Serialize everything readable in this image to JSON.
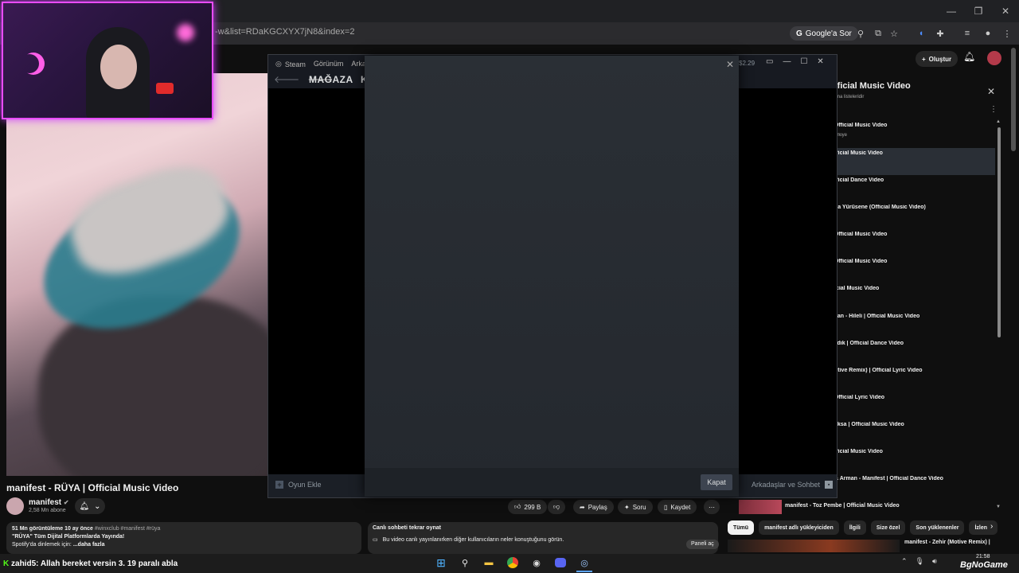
{
  "browser": {
    "url_fragment": "-w&list=RDaKGCXYX7jN8&index=2",
    "google_ask_label": "Google'a Sor",
    "window_controls": [
      "—",
      "❐",
      "✕"
    ]
  },
  "youtube": {
    "create_label": "Oluştur",
    "video_title": "manifest - RÜYA | Official Music Video",
    "channel_name": "manifest",
    "subscribers": "2,58 Mn abone",
    "likes": "299 B",
    "share_label": "Paylaş",
    "ask_label": "Soru",
    "save_label": "Kaydet",
    "description": {
      "meta": "51 Mn görüntüleme  10 ay önce",
      "tags": "#winxclub #manifest #rüya",
      "line2": "\"RÜYA\" Tüm Dijital Platformlarda Yayında!",
      "line3": "Spotify'da dinlemek için:",
      "more": "...daha fazla"
    },
    "chat_replay": {
      "title": "Canlı sohbeti tekrar oynat",
      "text": "Bu video canlı yayınlanırken diğer kullanıcıların neler konuştuğunu görün.",
      "panel_button": "Paneli aç"
    },
    "playlist": {
      "title": "fficial Music Video",
      "subtitle": "rma listeleridir",
      "items": [
        "Official Music Video",
        "fficial Music Video",
        "fficial Dance Video",
        "na Yürüsene (Official Music Video)",
        "Official Music Video",
        "Official Music Video",
        "icial Music Video",
        "kan - Hileli | Official Music Video",
        "zdık | Official Dance Video",
        "otive Remix) | Official Lyric Video",
        "Official Lyric Video",
        "aksa | Official Music Video",
        "fficial Music Video",
        "& Arman - Manifest | Official Dance Video"
      ],
      "first_item_sub": "ürkiye"
    },
    "next_video_title": "manifest - Toz Pembe | Official Music Video",
    "chips": [
      "Tümü",
      "manifest adlı yükleyiciden",
      "İlgili",
      "Size özel",
      "Son yüklenenler",
      "İzlen"
    ],
    "bottom_video_title": "manifest - Zehir (Motive Remix) |"
  },
  "steam": {
    "menu": [
      "Steam",
      "Görünüm",
      "Arkad"
    ],
    "store_label": "MAĞAZA",
    "k_label": "K",
    "wallet": "$2.29",
    "add_game_label": "Oyun Ekle",
    "friends_chat_label": "Arkadaşlar ve Sohbet",
    "modal_close_label": "Kapat"
  },
  "taskbar": {
    "chat_user": "zahid5",
    "chat_text": ": Allah bereket versin 3. 19 paralı abla",
    "time": "21:58",
    "watermark": "BgNoGame"
  }
}
